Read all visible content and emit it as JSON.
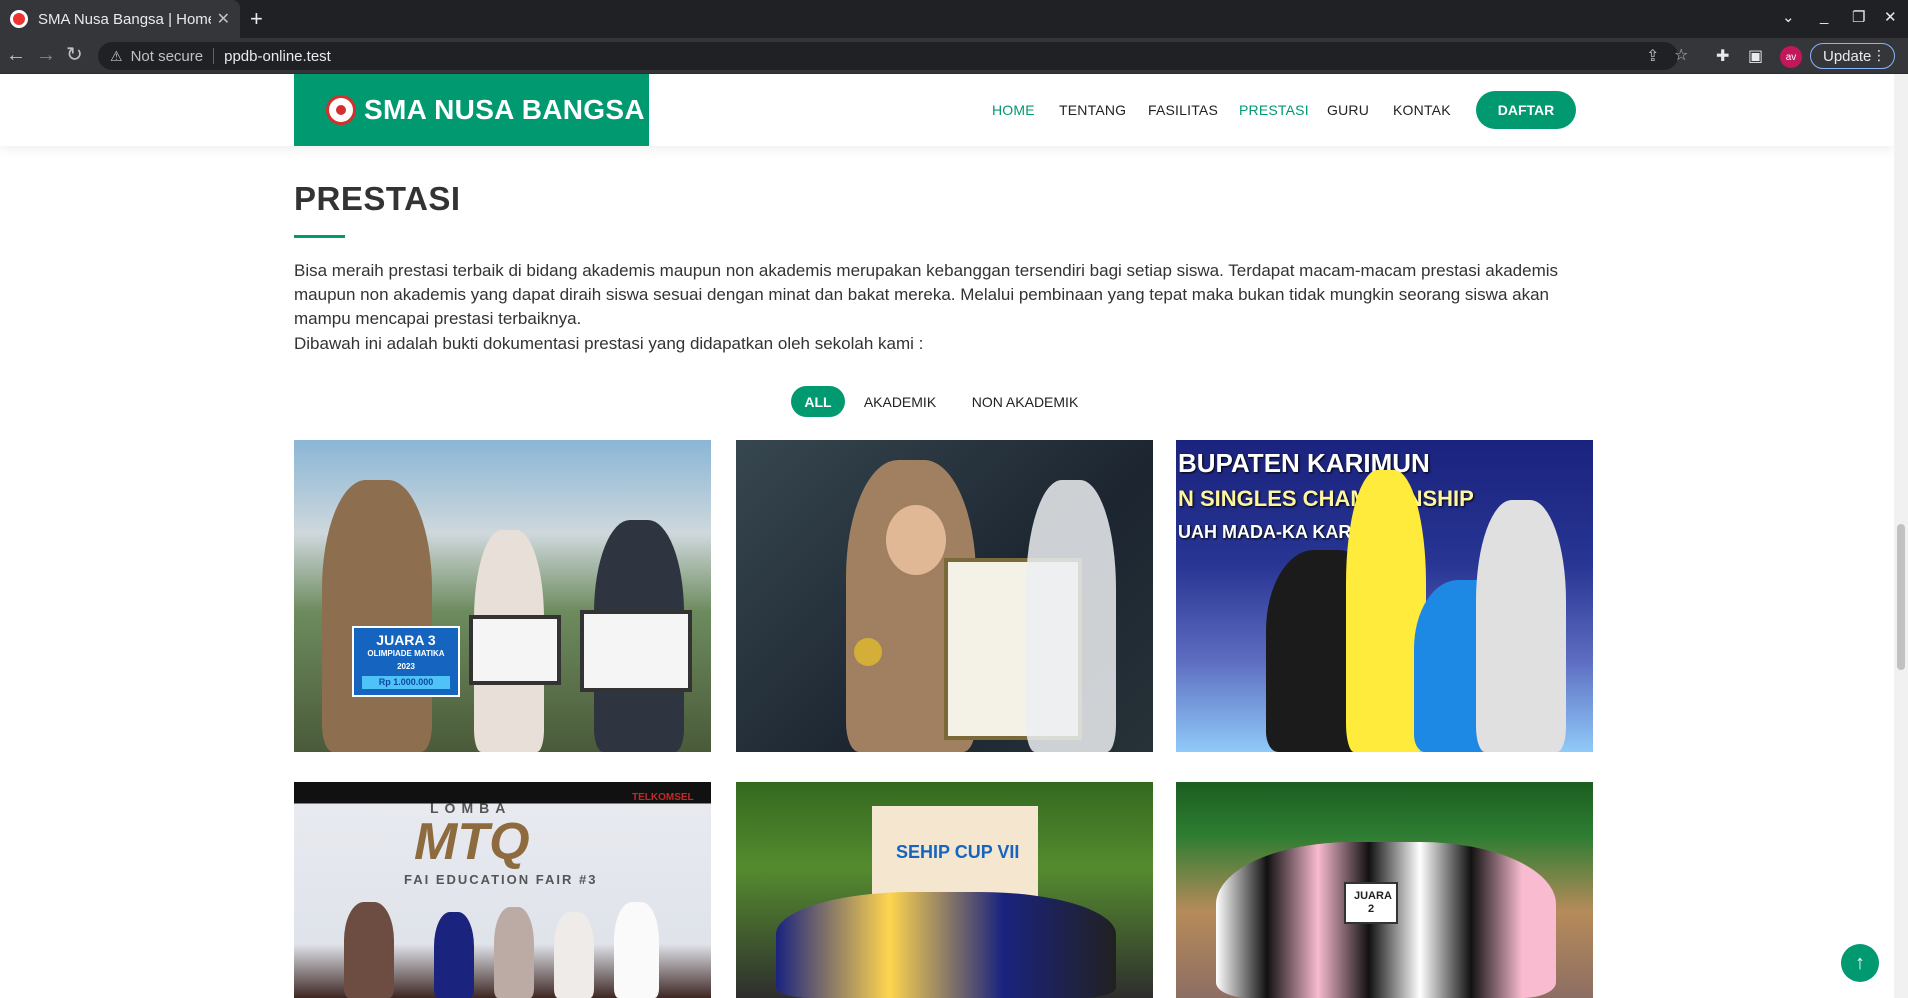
{
  "browser": {
    "tab_title": "SMA Nusa Bangsa | Home",
    "not_secure": "Not secure",
    "url": "ppdb-online.test",
    "profile_initials": "av",
    "update_label": "Update"
  },
  "site": {
    "brand": "SMA NUSA BANGSA",
    "accent_color": "#009970",
    "nav": [
      "HOME",
      "TENTANG",
      "FASILITAS",
      "PRESTASI",
      "GURU",
      "KONTAK"
    ],
    "cta": "DAFTAR"
  },
  "section": {
    "title": "PRESTASI",
    "description": "Bisa meraih prestasi terbaik di bidang akademis maupun non akademis merupakan kebanggan tersendiri bagi setiap siswa. Terdapat macam-macam prestasi akademis maupun non akademis yang dapat diraih siswa sesuai dengan minat dan bakat mereka. Melalui pembinaan yang tepat maka bukan tidak mungkin seorang siswa akan mampu mencapai prestasi terbaiknya.",
    "description2": "Dibawah ini adalah bukti dokumentasi prestasi yang didapatkan oleh sekolah kami :",
    "filters": [
      "ALL",
      "AKADEMIK",
      "NON AKADEMIK"
    ]
  },
  "gallery": {
    "photo1_caption": "JUARA 3",
    "photo1_sub": "OLIMPIADE MATIKA 2023",
    "photo1_prize": "Rp 1.000.000",
    "photo3_banner1": "BUPATEN KARIMUN",
    "photo3_banner2": "N SINGLES CHAMPIONSHIP",
    "photo3_banner3": "UAH MADA-KA KAR",
    "photo4_banner1": "LOMBA",
    "photo4_banner2": "MTQ",
    "photo4_banner3": "FAI EDUCATION FAIR #3",
    "photo4_logo": "TELKOMSEL",
    "photo5_banner": "SEHIP CUP VII",
    "photo6_caption": "JUARA 2"
  }
}
